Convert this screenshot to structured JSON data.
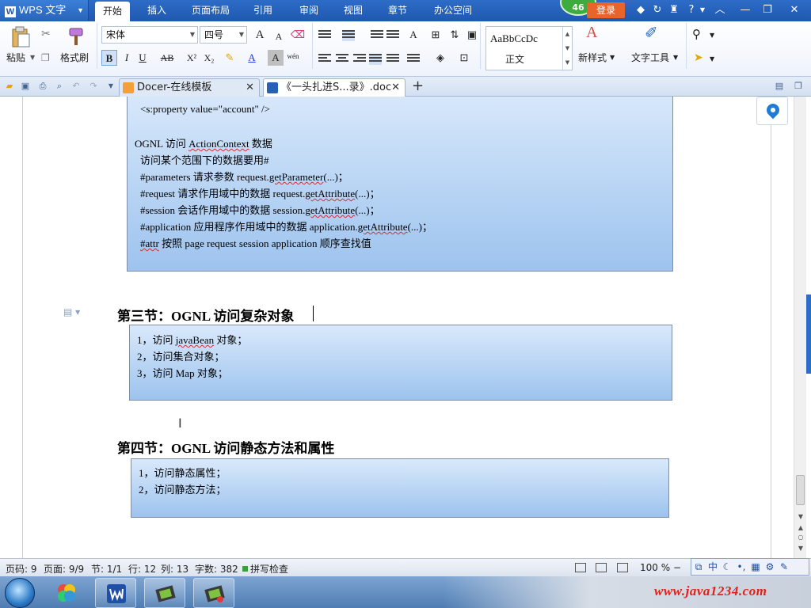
{
  "titlebar": {
    "app_name": "WPS 文字",
    "menu_tabs": [
      "开始",
      "插入",
      "页面布局",
      "引用",
      "审阅",
      "视图",
      "章节",
      "办公空间"
    ],
    "badge_count": "46",
    "login_label": "登录",
    "help_label": "?"
  },
  "ribbon": {
    "paste_label": "粘贴",
    "format_painter_label": "格式刷",
    "font_name": "宋体",
    "font_size": "四号",
    "style_sample": "AaBbCcDc",
    "style_name": "正文",
    "new_style_label": "新样式",
    "text_tools_label": "文字工具",
    "bold": "B",
    "italic": "I",
    "underline": "U",
    "strike": "AB",
    "superscript": "X²",
    "subscript": "X₂",
    "font_color": "A",
    "char_shade": "A",
    "phonetic": "wén",
    "grow_font": "A",
    "shrink_font": "A"
  },
  "tabs": {
    "tab1": "Docer-在线模板",
    "tab2": "《一头扎进S...录》.doc",
    "add": "+"
  },
  "document": {
    "box1_lines": [
      "<s:property value=\"account\" />",
      "OGNL 访问 ActionContext 数据",
      "访问某个范围下的数据要用#",
      "#parameters  请求参数    request.getParameter(...)；",
      "#request  请求作用域中的数据    request.getAttribute(...)；",
      "#session  会话作用域中的数据  session.getAttribute(...)；",
      "#application  应用程序作用域中的数据    application.getAttribute(...)；",
      "#attr  按照 page request session application 顺序查找值"
    ],
    "section3_title": "第三节：OGNL 访问复杂对象",
    "section3_items": [
      "1，访问 javaBean 对象；",
      "2，访问集合对象；",
      "3，访问 Map 对象；"
    ],
    "section4_title": "第四节：OGNL 访问静态方法和属性",
    "section4_items": [
      "1，访问静态属性；",
      "2，访问静态方法；"
    ]
  },
  "statusbar": {
    "page_num": "页码: 9",
    "pages": "页面: 9/9",
    "section": "节: 1/1",
    "row": "行: 12",
    "col": "列: 13",
    "word_count": "字数: 382",
    "spell_check": "拼写检查",
    "zoom": "100 %",
    "zoom_minus": "−"
  },
  "ime": {
    "mode": "中"
  },
  "watermark": {
    "text": "www.java1234.com"
  },
  "colors": {
    "title_blue": "#1f58b0",
    "box_top": "#d9e9fb",
    "box_bottom": "#9dc3ee",
    "login_orange": "#e8642a",
    "badge_green": "#3eab3e",
    "watermark_red": "#e0201a"
  }
}
